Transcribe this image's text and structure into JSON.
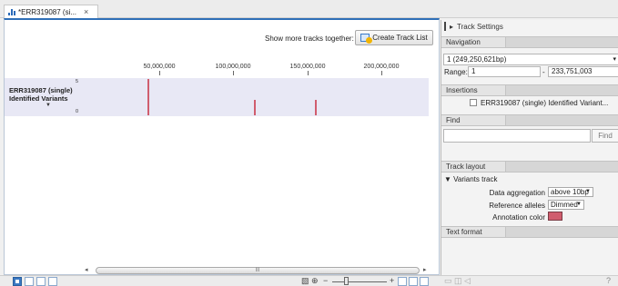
{
  "tab": {
    "title": "*ERR319087 (si...",
    "close": "×"
  },
  "toolbar": {
    "show_more_label": "Show more tracks together:",
    "create_track_list_label": "Create Track List"
  },
  "ruler": {
    "labels": [
      "50,000,000",
      "100,000,000",
      "150,000,000",
      "200,000,000"
    ]
  },
  "track": {
    "name_line1": "ERR319087 (single)",
    "name_line2": "Identified Variants",
    "collapse_arrow": "▼",
    "y_max": "5",
    "y_min": "0",
    "color": "#d05d6e"
  },
  "scrollbar": {
    "left_arrow": "◂",
    "right_arrow": "▸",
    "grip": "III"
  },
  "zoom_tools": {
    "zoom_icon": "🔍",
    "minus": "−",
    "plus": "+"
  },
  "side_panel": {
    "title": "Track Settings",
    "navigation": {
      "header": "Navigation",
      "chromosome": "1 (249,250,621bp)",
      "range_label": "Range:",
      "range_from": "1",
      "range_dash": "-",
      "range_to": "233,751,003"
    },
    "insertions": {
      "header": "Insertions",
      "item_label": "ERR319087 (single) Identified Variant..."
    },
    "find": {
      "header": "Find",
      "button_label": "Find",
      "value": ""
    },
    "track_layout": {
      "header": "Track layout",
      "variants_track": "▼ Variants track",
      "data_aggregation_label": "Data aggregation",
      "data_aggregation_value": "above 10bp",
      "reference_alleles_label": "Reference alleles",
      "reference_alleles_value": "Dimmed",
      "annotation_color_label": "Annotation color",
      "annotation_color": "#d05d6e"
    },
    "text_format": {
      "header": "Text format"
    }
  }
}
